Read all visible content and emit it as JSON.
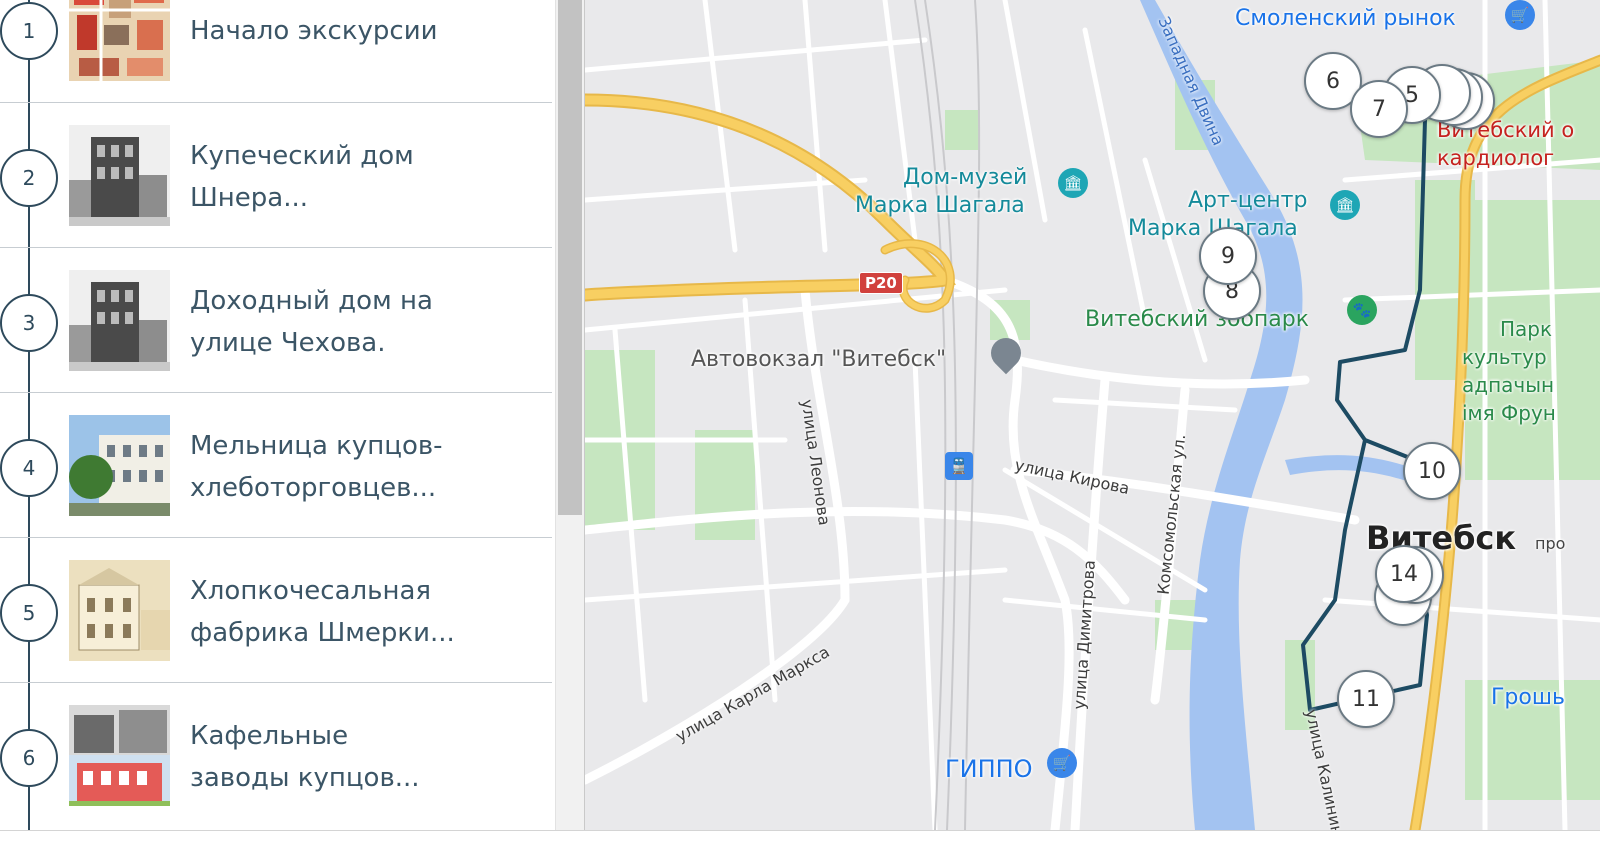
{
  "tour": {
    "items": [
      {
        "number": "1",
        "title": "Начало экскурсии"
      },
      {
        "number": "2",
        "title": "Купеческий дом\nШнера..."
      },
      {
        "number": "3",
        "title": "Доходный дом на\nулице Чехова."
      },
      {
        "number": "4",
        "title": "Мельница купцов-\nхлеботорговцев..."
      },
      {
        "number": "5",
        "title": "Хлопкочесальная\nфабрика Шмерки..."
      },
      {
        "number": "6",
        "title": "Кафельные\nзаводы купцов..."
      }
    ]
  },
  "map": {
    "pois": {
      "smolensk_market": "Смоленский рынок",
      "chagall_museum_line1": "Дом-музей",
      "chagall_museum_line2": "Марка Шагала",
      "art_center_line1": "Арт-центр",
      "art_center_line2": "Марка Шагала",
      "zoo": "Витебский зоопарк",
      "bus_station": "Автовокзал \"Витебск\"",
      "hippo": "ГИППО",
      "cardio_line1": "Витебский о",
      "cardio_line2": "кардиолог",
      "park_line1": "Парк",
      "park_line2": "культур",
      "park_line3": "адпачын",
      "park_line4": "імя Фрун",
      "city": "Витебск",
      "city_suffix": "про",
      "groshy": "Грошь",
      "river": "Западная Двина"
    },
    "streets": {
      "kirova": "улица Кирова",
      "leonova": "улица Леонова",
      "dimitrova": "улица Димитрова",
      "komsomolskaya": "Комсомольская ул.",
      "karla_marksa": "улица Карла Маркса",
      "kalinina": "улица Калинин"
    },
    "road_shield": "P20",
    "markers": [
      "6",
      "7",
      "5",
      "9",
      "8",
      "10",
      "14",
      "11"
    ]
  },
  "colors": {
    "accent": "#2e4a5c",
    "route": "#1d4b63",
    "river": "#a3c3f1",
    "highway": "#f8cf62",
    "park": "#c6e6c0",
    "poi_teal": "#1ea6b5",
    "poi_blue": "#3a86e9",
    "poi_green": "#2aa45f"
  }
}
